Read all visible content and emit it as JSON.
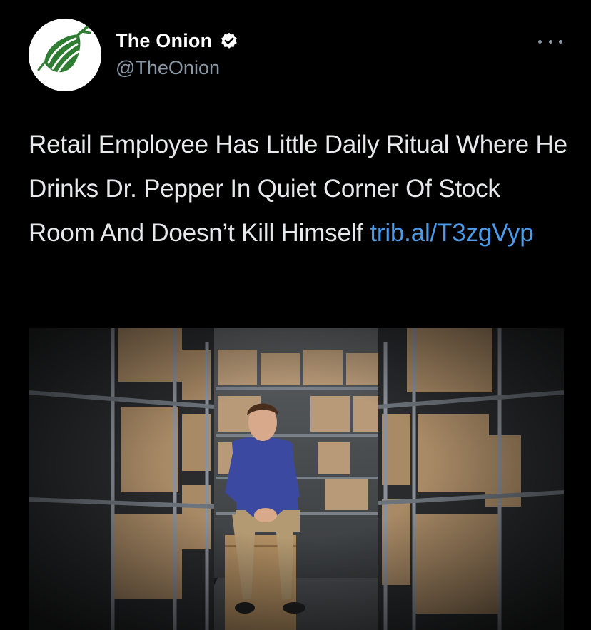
{
  "account": {
    "display_name": "The Onion",
    "handle": "@TheOnion",
    "verified": true,
    "avatar_icon": "onion-logo-icon",
    "avatar_color": "#2e7d32"
  },
  "tweet": {
    "text": "Retail Employee Has Little Daily Ritual Where He Drinks Dr. Pepper In Quiet Corner Of Stock Room And Doesn’t Kill Himself",
    "link": "trib.al/T3zgVyp",
    "link_color": "#4c9be8"
  },
  "icons": {
    "verified": "verified-badge-icon",
    "more": "more-options-icon"
  },
  "media": {
    "description_icon": "photo-stockroom"
  }
}
